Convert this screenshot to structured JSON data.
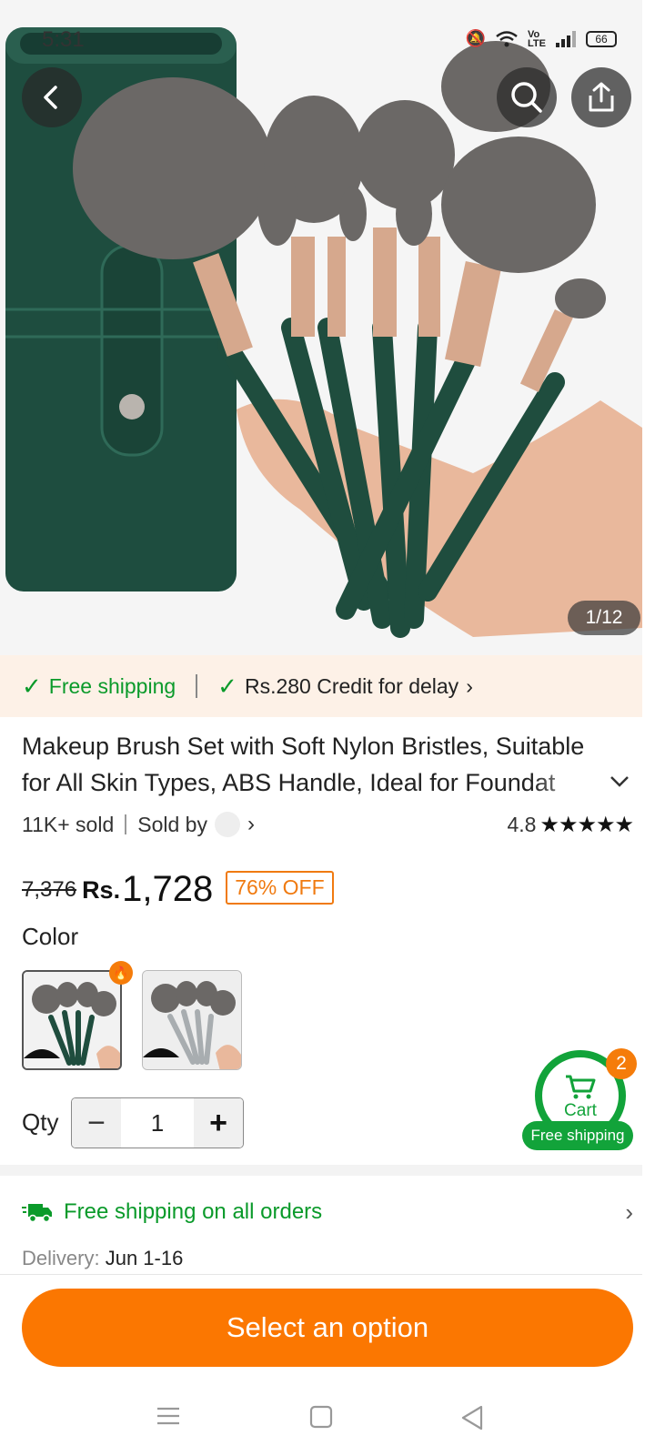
{
  "status_bar": {
    "time": "5:31",
    "battery": "66",
    "icons": [
      "mute-icon",
      "wifi-icon",
      "volte-icon",
      "signal-icon",
      "battery-icon"
    ]
  },
  "gallery": {
    "counter": "1/12"
  },
  "shipping_banner": {
    "free_shipping": "Free shipping",
    "credit": "Rs.280 Credit for delay"
  },
  "product": {
    "title": "Makeup Brush Set with Soft Nylon Bristles, Suitable for All Skin Types, ABS Handle, Ideal for Foundat",
    "sold": "11K+ sold",
    "sold_by": "Sold by",
    "rating": "4.8",
    "stars": "★★★★★",
    "old_price": "7,376",
    "currency": "Rs.",
    "price": "1,728",
    "discount": "76% OFF"
  },
  "options": {
    "color_label": "Color",
    "qty_label": "Qty",
    "qty_value": "1",
    "minus": "−",
    "plus": "+"
  },
  "cart": {
    "label": "Cart",
    "count": "2",
    "free_shipping": "Free shipping"
  },
  "shipping": {
    "title": "Free shipping on all orders",
    "delivery_label": "Delivery:",
    "delivery_value": "Jun 1-16"
  },
  "cta": {
    "label": "Select an option"
  },
  "colors": {
    "accent": "#fb7701",
    "green": "#0a9a2a",
    "banner_bg": "#fdf1e7"
  }
}
